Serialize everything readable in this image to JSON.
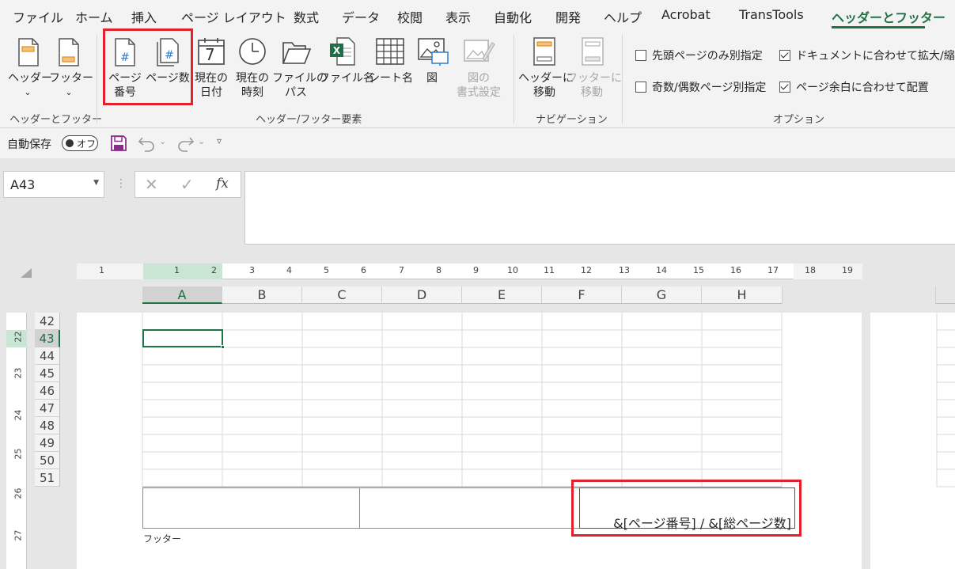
{
  "ribbon": {
    "tabs": [
      "ファイル",
      "ホーム",
      "挿入",
      "ページ レイアウト",
      "数式",
      "データ",
      "校閲",
      "表示",
      "自動化",
      "開発",
      "ヘルプ",
      "Acrobat",
      "TransTools",
      "ヘッダーとフッター"
    ],
    "active_tab": "ヘッダーとフッター",
    "groups": {
      "header_footer": {
        "label": "ヘッダーとフッター",
        "header_btn": "ヘッダー",
        "footer_btn": "フッター"
      },
      "elements": {
        "label": "ヘッダー/フッター要素",
        "page_number": [
          "ページ",
          "番号"
        ],
        "page_count": "ページ数",
        "current_date": [
          "現在の",
          "日付"
        ],
        "current_time": [
          "現在の",
          "時刻"
        ],
        "file_path": [
          "ファイルの",
          "パス"
        ],
        "file_name": "ファイル名",
        "sheet_name": "シート名",
        "picture": "図",
        "format_picture": [
          "図の",
          "書式設定"
        ],
        "calendar_day": "7"
      },
      "navigation": {
        "label": "ナビゲーション",
        "goto_header": [
          "ヘッダーに",
          "移動"
        ],
        "goto_footer": [
          "フッターに",
          "移動"
        ]
      },
      "options": {
        "label": "オプション",
        "different_first_page": {
          "label": "先頭ページのみ別指定",
          "checked": false
        },
        "different_odd_even": {
          "label": "奇数/偶数ページ別指定",
          "checked": false
        },
        "scale_with_document": {
          "label": "ドキュメントに合わせて拡大/縮小",
          "checked": true
        },
        "align_with_margins": {
          "label": "ページ余白に合わせて配置",
          "checked": true
        }
      }
    }
  },
  "qat": {
    "autosave_label": "自動保存",
    "autosave_state": "オフ"
  },
  "formula_bar": {
    "name_box": "A43",
    "fx": "fx",
    "value": ""
  },
  "sheet": {
    "ruler_numbers": [
      "1",
      "1",
      "2",
      "3",
      "4",
      "5",
      "6",
      "7",
      "8",
      "9",
      "10",
      "11",
      "12",
      "13",
      "14",
      "15",
      "16",
      "17",
      "18",
      "19"
    ],
    "vertical_ruler_numbers": [
      "22",
      "23",
      "24",
      "25",
      "26",
      "27"
    ],
    "columns": [
      "A",
      "B",
      "C",
      "D",
      "E",
      "F",
      "G",
      "H"
    ],
    "selected_column": "A",
    "rows": [
      "42",
      "43",
      "44",
      "45",
      "46",
      "47",
      "48",
      "49",
      "50",
      "51"
    ],
    "selected_row": "43",
    "footer_label": "フッター",
    "footer_right_text": "&[ページ番号] / &[総ページ数]"
  },
  "colors": {
    "accent": "#217346",
    "highlight": "#e3212b"
  }
}
